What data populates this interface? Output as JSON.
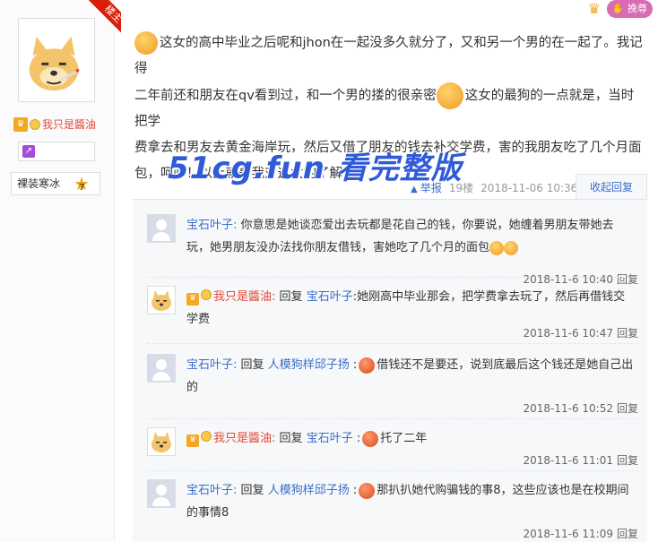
{
  "sidebar": {
    "ribbon_label": "楼主",
    "level_name": "我只是醬油",
    "tag_label": "裸装寒冰",
    "tag_level": "7"
  },
  "header": {
    "upgrade_label": "挽尊"
  },
  "post": {
    "line1": "这女的高中毕业之后呢和jhon在一起没多久就分了，又和另一个男的在一起了。我记得",
    "line2a": "二年前还和朋友在qv看到过，和一个男的搂的很亲密",
    "line2b": "这女的最狗的一点就是，当时把学",
    "line3": "费拿去和男友去黄金海岸玩，然后又借了朋友的钱去补交学费，害的我朋友吃了几个月面",
    "line4": "包，呵呵！以上就是我对这女的了解",
    "watermark": "51cg.fun 看完整版",
    "report_label": "举报",
    "floor": "19楼",
    "datetime": "2018-11-06 10:36",
    "collapse_label": "收起回复"
  },
  "replies": [
    {
      "avatar": "default-avatar",
      "user": "宝石叶子:",
      "reply_word": "",
      "target": "",
      "text": "你意思是她谈恋爱出去玩都是花自己的钱，你要说，她缠着男朋友带她去玩，她男朋友没办法找你朋友借钱，害她吃了几个月的面包",
      "time": "2018-11-6 10:40",
      "reply_label": "回复"
    },
    {
      "avatar": "dog-avatar",
      "user": "我只是醬油:",
      "reply_word": "回复",
      "target": "宝石叶子",
      "text": ":她刚高中毕业那会，把学费拿去玩了，然后再借钱交学费",
      "time": "2018-11-6 10:47",
      "reply_label": "回复"
    },
    {
      "avatar": "default-avatar",
      "user": "宝石叶子:",
      "reply_word": "回复",
      "target": "人模狗样邱子扬",
      "text": "借钱还不是要还，说到底最后这个钱还是她自己出的",
      "time": "2018-11-6 10:52",
      "reply_label": "回复"
    },
    {
      "avatar": "dog-avatar",
      "user": "我只是醬油:",
      "reply_word": "回复",
      "target": "宝石叶子",
      "text": "托了二年",
      "time": "2018-11-6 11:01",
      "reply_label": "回复"
    },
    {
      "avatar": "default-avatar",
      "user": "宝石叶子:",
      "reply_word": "回复",
      "target": "人模狗样邱子扬",
      "text": "那扒扒她代购骗钱的事8，这些应该也是在校期间的事情8",
      "time": "2018-11-6 11:09",
      "reply_label": "回复"
    }
  ]
}
